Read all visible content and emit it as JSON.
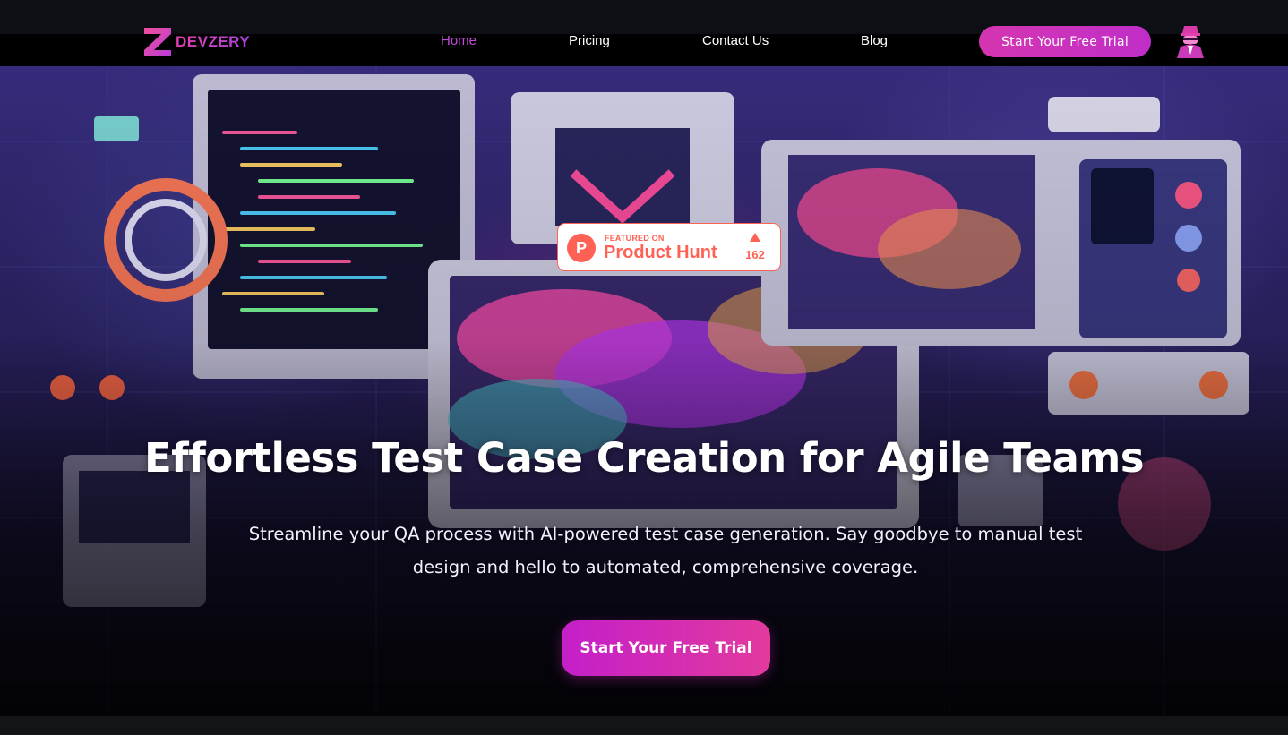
{
  "brand": {
    "name": "DEVZERY"
  },
  "nav": {
    "links": [
      {
        "label": "Home",
        "active": true
      },
      {
        "label": "Pricing",
        "active": false
      },
      {
        "label": "Contact Us",
        "active": false
      },
      {
        "label": "Blog",
        "active": false
      }
    ],
    "cta_label": "Start Your Free Trial",
    "avatar_icon": "spy-agent-icon"
  },
  "product_hunt_badge": {
    "featured_text": "FEATURED ON",
    "name": "Product Hunt",
    "icon_letter": "P",
    "upvotes": "162"
  },
  "hero": {
    "title": "Effortless Test Case Creation for Agile Teams",
    "subtitle": "Streamline your QA process with AI-powered test case generation. Say goodbye to manual test design and hello to automated, comprehensive coverage.",
    "cta_label": "Start Your Free Trial"
  },
  "colors": {
    "accent": "#c34ad8",
    "cta_gradient_start": "#c41fc9",
    "cta_gradient_end": "#e23a9d",
    "product_hunt": "#ff6154",
    "navbar_bg": "#000000"
  }
}
